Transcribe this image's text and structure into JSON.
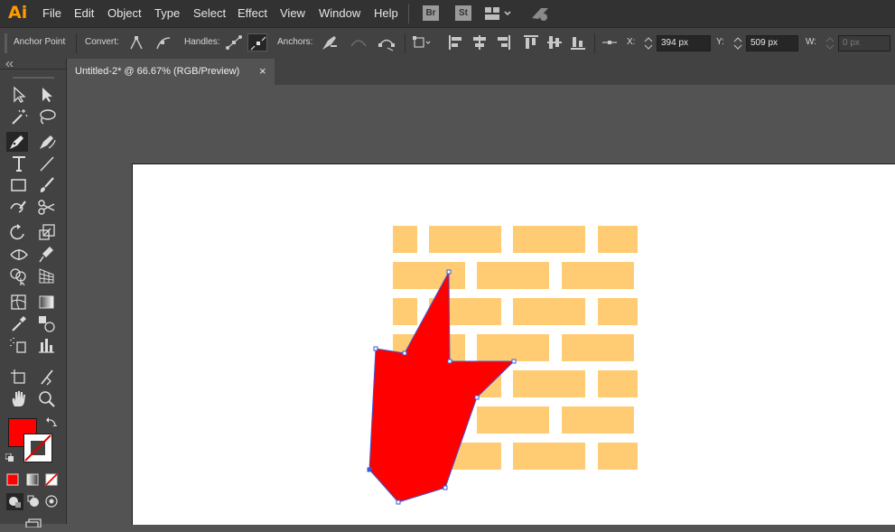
{
  "app": {
    "logo": "Ai",
    "menu": [
      "File",
      "Edit",
      "Object",
      "Type",
      "Select",
      "Effect",
      "View",
      "Window",
      "Help"
    ],
    "bridge_label": "Br",
    "stock_label": "St"
  },
  "control_bar": {
    "tool_name": "Anchor Point",
    "convert_label": "Convert:",
    "handles_label": "Handles:",
    "anchors_label": "Anchors:",
    "x_label": "X:",
    "x_value": "394 px",
    "y_label": "Y:",
    "y_value": "509 px",
    "w_label": "W:",
    "w_value": "0 px"
  },
  "document": {
    "tab_title": "Untitled-2* @ 66.67% (RGB/Preview)",
    "close_symbol": "×"
  },
  "colors": {
    "fill": "#ff0000",
    "stroke": "none",
    "brick": "#ffcc73",
    "selection": "#3b5bdb"
  },
  "toolbox": {
    "tools": [
      "selection-tool",
      "direct-selection-tool",
      "magic-wand-tool",
      "lasso-tool",
      "pen-tool",
      "curvature-tool",
      "type-tool",
      "line-segment-tool",
      "rectangle-tool",
      "paintbrush-tool",
      "shaper-tool",
      "scissors-tool",
      "rotate-tool",
      "scale-tool",
      "width-tool",
      "puppet-warp-tool",
      "shape-builder-tool",
      "perspective-grid-tool",
      "mesh-tool",
      "gradient-tool",
      "eyedropper-tool",
      "blend-tool",
      "symbol-sprayer-tool",
      "column-graph-tool",
      "artboard-tool",
      "slice-tool",
      "hand-tool",
      "zoom-tool"
    ],
    "active_tool": "pen-tool"
  }
}
